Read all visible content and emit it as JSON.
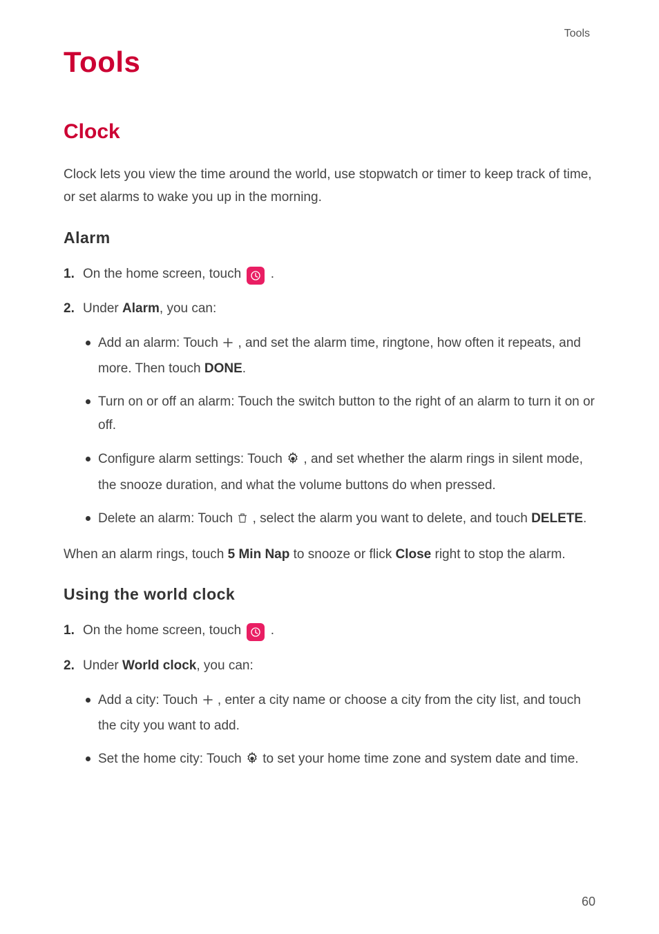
{
  "header": {
    "section_label": "Tools"
  },
  "h1": "Tools",
  "clock": {
    "title": "Clock",
    "intro": "Clock lets you view the time around the world, use stopwatch or timer to keep track of time, or set alarms to wake you up in the morning.",
    "alarm": {
      "title": "Alarm",
      "step1_num": "1.",
      "step1_text": "On the home screen, touch ",
      "step1_after": ".",
      "step2_num": "2.",
      "step2_pre": "Under ",
      "step2_bold": "Alarm",
      "step2_post": ", you can:",
      "bullets": {
        "b1_pre": "Add an alarm: Touch ",
        "b1_post": ", and set the alarm time, ringtone, how often it repeats, and more. Then touch ",
        "b1_done": "DONE",
        "b1_end": ".",
        "b2": "Turn on or off an alarm: Touch the switch button to the right of an alarm to turn it on or off.",
        "b3_pre": "Configure alarm settings: Touch ",
        "b3_post": ", and set whether the alarm rings in silent mode, the snooze duration, and what the volume buttons do when pressed.",
        "b4_pre": "Delete an alarm: Touch ",
        "b4_post": ", select the alarm you want to delete, and touch ",
        "b4_delete": "DELETE",
        "b4_end": "."
      },
      "footer_pre": "When an alarm rings, touch ",
      "footer_b1": "5 Min Nap",
      "footer_mid": " to snooze or flick ",
      "footer_b2": "Close",
      "footer_post": " right to stop the alarm."
    },
    "world": {
      "title": "Using  the  world  clock",
      "step1_num": "1.",
      "step1_text": "On the home screen, touch ",
      "step1_after": ".",
      "step2_num": "2.",
      "step2_pre": "Under ",
      "step2_bold": "World clock",
      "step2_post": ", you can:",
      "bullets": {
        "b1_pre": "Add a city: Touch ",
        "b1_post": ", enter a city name or choose a city from the city list, and touch the city you want to add.",
        "b2_pre": "Set the home city: Touch ",
        "b2_post": " to set your home time zone and system date and time."
      }
    }
  },
  "page_number": "60"
}
